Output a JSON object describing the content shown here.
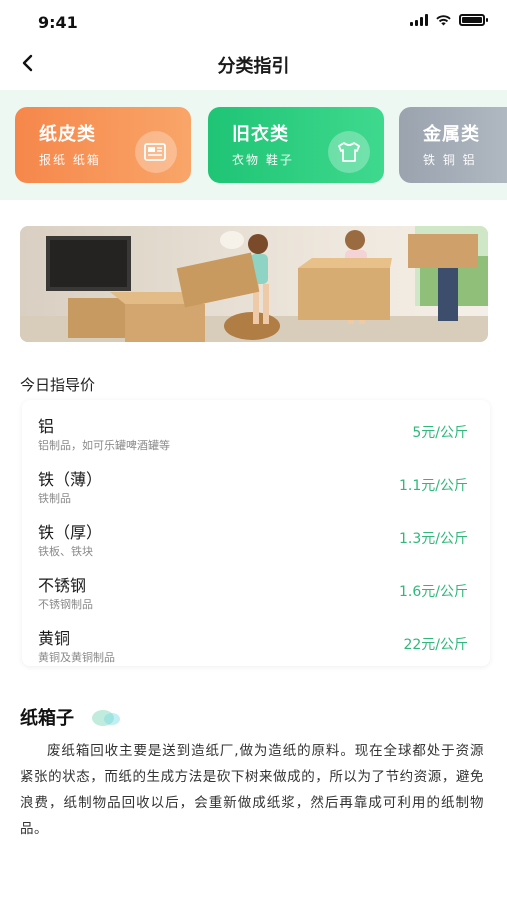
{
  "status_bar": {
    "time": "9:41"
  },
  "nav": {
    "title": "分类指引"
  },
  "categories": [
    {
      "title": "纸皮类",
      "subtitle": "报纸 纸箱",
      "icon": "newspaper-icon",
      "color": "#f6874b"
    },
    {
      "title": "旧衣类",
      "subtitle": "衣物 鞋子",
      "icon": "tshirt-icon",
      "color": "#1fc475"
    },
    {
      "title": "金属类",
      "subtitle": "铁 铜 铝",
      "icon": "metal-icon",
      "color": "#9aa3ae"
    }
  ],
  "banner": {
    "description": "children-carrying-cardboard-boxes-photo"
  },
  "price_section": {
    "title": "今日指导价",
    "items": [
      {
        "name": "铝",
        "desc": "铝制品，如可乐罐啤酒罐等",
        "price": "5元/公斤"
      },
      {
        "name": "铁（薄）",
        "desc": "铁制品",
        "price": "1.1元/公斤"
      },
      {
        "name": "铁（厚）",
        "desc": "铁板、铁块",
        "price": "1.3元/公斤"
      },
      {
        "name": "不锈钢",
        "desc": "不锈钢制品",
        "price": "1.6元/公斤"
      },
      {
        "name": "黄铜",
        "desc": "黄铜及黄铜制品",
        "price": "22元/公斤"
      }
    ]
  },
  "article": {
    "title": "纸箱子",
    "body": "废纸箱回收主要是送到造纸厂,做为造纸的原料。现在全球都处于资源紧张的状态，而纸的生成方法是砍下树来做成的，所以为了节约资源，避免浪费，纸制物品回收以后，会重新做成纸浆，然后再靠成可利用的纸制物品。"
  },
  "colors": {
    "accent_green": "#2fb87a",
    "strip_bg": "#eef8f2"
  }
}
